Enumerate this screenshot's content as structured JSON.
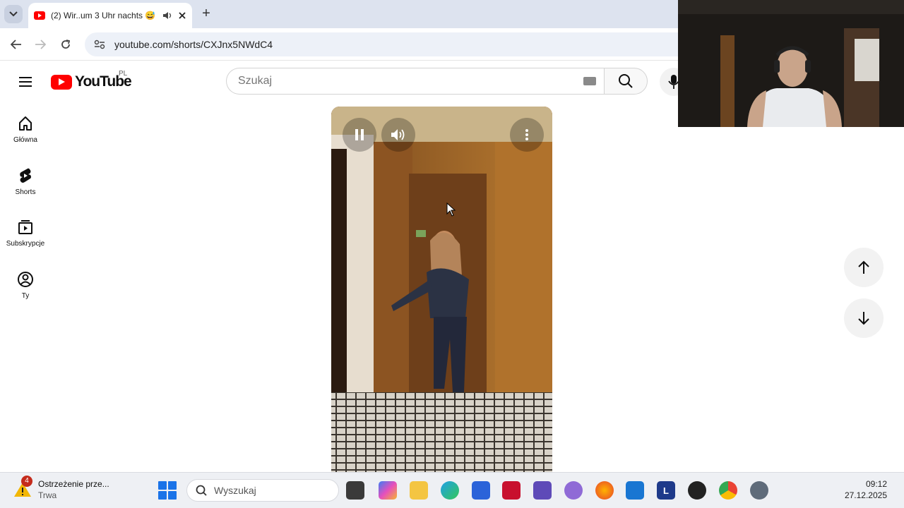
{
  "browser": {
    "tab_title": "(2) Wir..um 3 Uhr nachts 😅",
    "new_tab_label": "+",
    "url": "youtube.com/shorts/CXJnx5NWdC4"
  },
  "youtube": {
    "logo_text": "YouTube",
    "country_code": "PL",
    "search_placeholder": "Szukaj"
  },
  "sidebar": {
    "items": [
      {
        "label": "Główna",
        "icon": "home-icon"
      },
      {
        "label": "Shorts",
        "icon": "shorts-icon"
      },
      {
        "label": "Subskrypcje",
        "icon": "subscriptions-icon"
      },
      {
        "label": "Ty",
        "icon": "account-icon"
      }
    ]
  },
  "shorts": {
    "controls": [
      "pause-icon",
      "volume-icon",
      "more-icon"
    ],
    "navigation": [
      "arrow-up-icon",
      "arrow-down-icon"
    ]
  },
  "taskbar": {
    "weather_title": "Ostrzeżenie prze...",
    "weather_status": "Trwa",
    "weather_badge": "4",
    "search_placeholder": "Wyszukaj",
    "time": "09:12",
    "date": "27.12.2025",
    "apps": [
      "terminal-icon",
      "copilot-icon",
      "file-explorer-icon",
      "edge-icon",
      "store-icon",
      "mcafee-icon",
      "vpn-icon",
      "app-icon",
      "firefox-icon",
      "outlook-icon",
      "l-app-icon",
      "obs-icon",
      "chrome-icon",
      "settings-icon"
    ],
    "l_app_label": "L"
  }
}
